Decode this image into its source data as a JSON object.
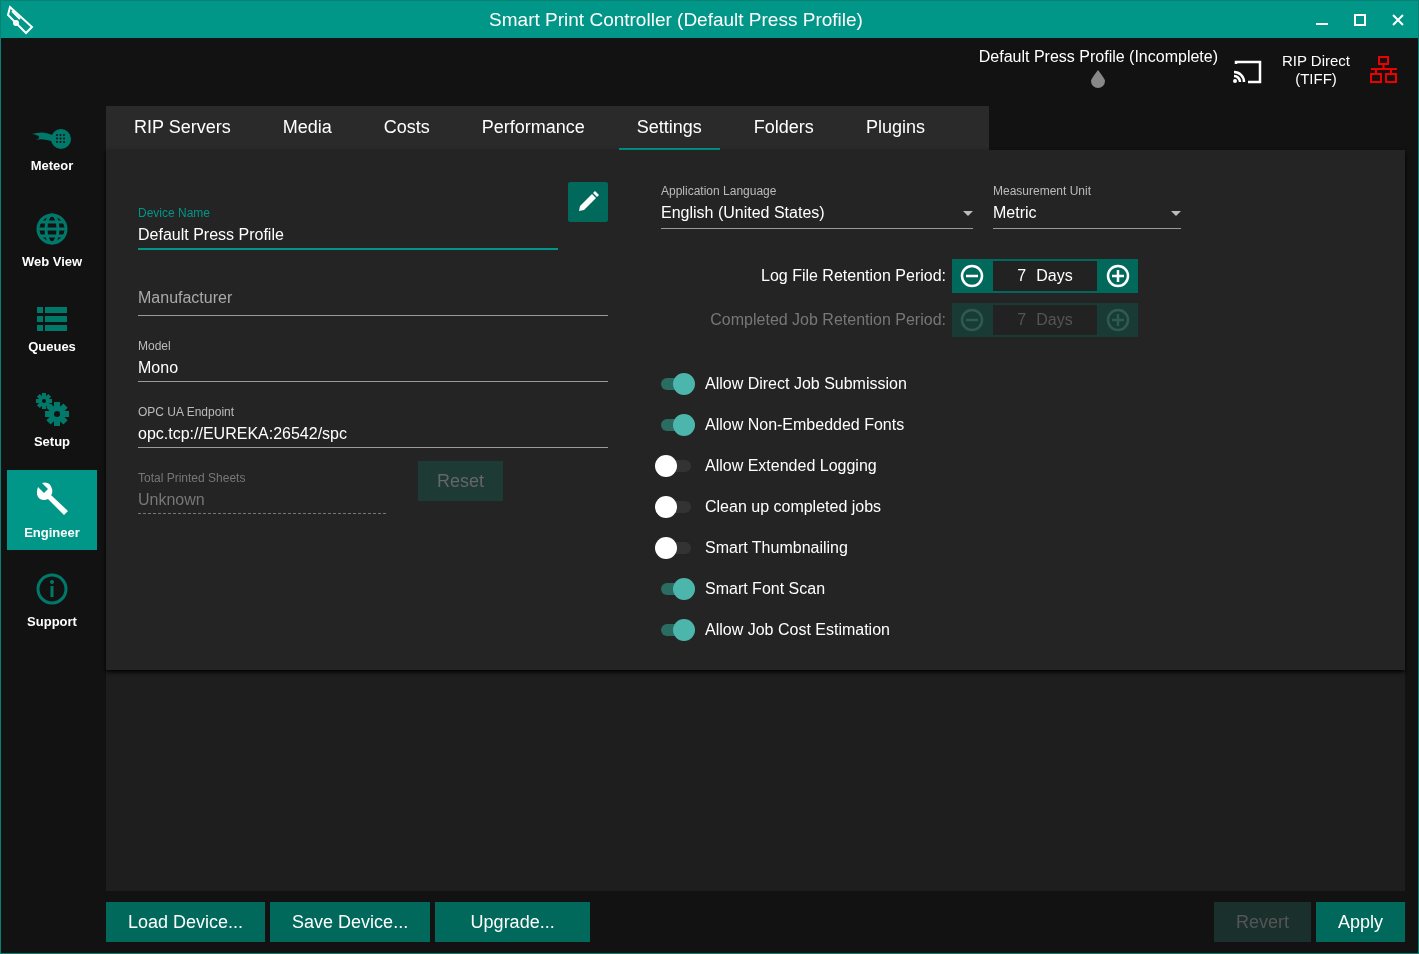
{
  "window": {
    "title": "Smart Print Controller (Default Press Profile)"
  },
  "header": {
    "profile_status": "Default Press Profile (Incomplete)",
    "rip_mode": "RIP Direct (TIFF)"
  },
  "sidebar": {
    "items": [
      {
        "label": "Meteor",
        "kind": "meteor",
        "selected": false
      },
      {
        "label": "Web View",
        "kind": "globe",
        "selected": false
      },
      {
        "label": "Queues",
        "kind": "list",
        "selected": false
      },
      {
        "label": "Setup",
        "kind": "gears",
        "selected": false
      },
      {
        "label": "Engineer",
        "kind": "wrench",
        "selected": true
      },
      {
        "label": "Support",
        "kind": "info",
        "selected": false
      }
    ]
  },
  "tabs": [
    {
      "label": "RIP Servers",
      "selected": false
    },
    {
      "label": "Media",
      "selected": false
    },
    {
      "label": "Costs",
      "selected": false
    },
    {
      "label": "Performance",
      "selected": false
    },
    {
      "label": "Settings",
      "selected": true
    },
    {
      "label": "Folders",
      "selected": false
    },
    {
      "label": "Plugins",
      "selected": false
    }
  ],
  "device_fields": [
    {
      "label": "Device Name",
      "value": "Default Press Profile",
      "focused": true,
      "disabled": false
    },
    {
      "placeholder": "Manufacturer",
      "focused": false,
      "disabled": false
    },
    {
      "label": "Model",
      "value": "Mono",
      "focused": false,
      "disabled": false
    },
    {
      "label": "OPC UA Endpoint",
      "value": "opc.tcp://EUREKA:26542/spc",
      "focused": false,
      "disabled": false
    },
    {
      "label": "Total Printed Sheets",
      "value": "Unknown",
      "focused": false,
      "disabled": true
    }
  ],
  "reset_button": {
    "label": "Reset",
    "disabled": true
  },
  "dropdowns": [
    {
      "label": "Application Language",
      "value": "English (United States)"
    },
    {
      "label": "Measurement Unit",
      "value": "Metric"
    }
  ],
  "steppers": [
    {
      "label": "Log File Retention Period:",
      "value": "7",
      "unit": "Days",
      "disabled": false
    },
    {
      "label": "Completed Job Retention Period:",
      "value": "7",
      "unit": "Days",
      "disabled": true
    }
  ],
  "toggles": [
    {
      "label": "Allow Direct Job Submission",
      "on": true
    },
    {
      "label": "Allow Non-Embedded Fonts",
      "on": true
    },
    {
      "label": "Allow Extended Logging",
      "on": false
    },
    {
      "label": "Clean up completed jobs",
      "on": false
    },
    {
      "label": "Smart Thumbnailing",
      "on": false
    },
    {
      "label": "Smart Font Scan",
      "on": true
    },
    {
      "label": "Allow Job Cost Estimation",
      "on": true
    }
  ],
  "footer": {
    "left_buttons": [
      {
        "label": "Load Device...",
        "disabled": false
      },
      {
        "label": "Save Device...",
        "disabled": false
      },
      {
        "label": "Upgrade...",
        "disabled": false
      }
    ],
    "right_buttons": [
      {
        "label": "Revert",
        "disabled": true
      },
      {
        "label": "Apply",
        "disabled": false
      }
    ]
  }
}
